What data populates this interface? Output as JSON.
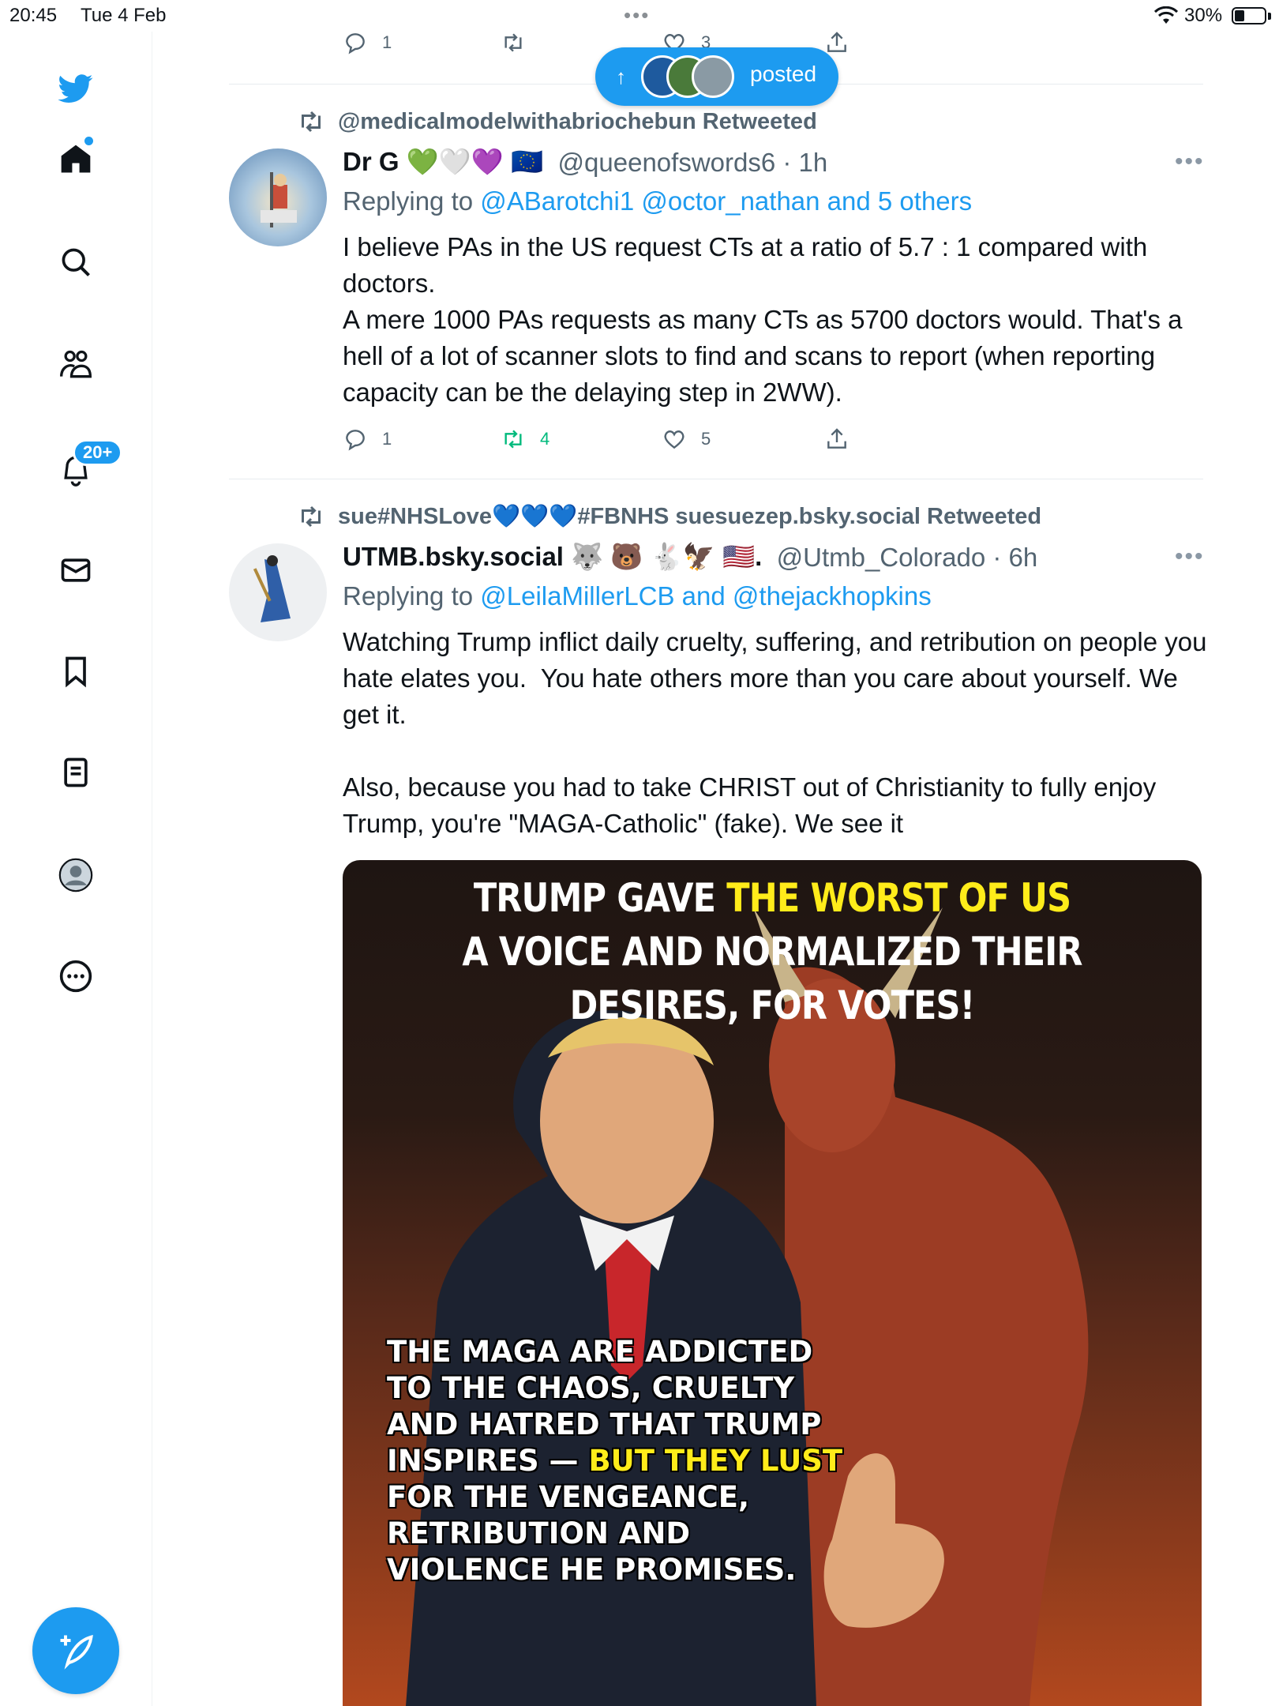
{
  "status_bar": {
    "time": "20:45",
    "date": "Tue 4 Feb",
    "battery": "30%"
  },
  "sidebar": {
    "notif_badge": "20+"
  },
  "new_posts": {
    "label": "posted"
  },
  "top_actions": {
    "reply_count": "1",
    "like_count": "3"
  },
  "tweet1": {
    "retweeted_by": "@medicalmodelwithabriochebun Retweeted",
    "display_name": "Dr G 💚🤍💜 🇪🇺",
    "handle_time": "@queenofswords6 · 1h",
    "replying_prefix": "Replying to ",
    "replying_to": "@ABarotchi1 @octor_nathan and 5 others",
    "text": "I believe PAs in the US request CTs at a ratio of 5.7 : 1 compared with doctors.\nA mere 1000 PAs requests as many CTs as 5700 doctors would. That's a hell of a lot of scanner slots to find and scans to report (when reporting capacity can be the delaying step in 2WW).",
    "reply_count": "1",
    "retweet_count": "4",
    "like_count": "5"
  },
  "tweet2": {
    "retweeted_by": "sue#NHSLove💙💙💙#FBNHS suesuezep.bsky.social Retweeted",
    "display_name": "UTMB.bsky.social 🐺 🐻 🐇🦅 🇺🇸.",
    "handle_time": "@Utmb_Colorado · 6h",
    "replying_prefix": "Replying to ",
    "replying_to": "@LeilaMillerLCB and @thejackhopkins",
    "text": "Watching Trump inflict daily cruelty, suffering, and retribution on people you hate elates you.  You hate others more than you care about yourself. We get it.\n\nAlso, because you had to take CHRIST out of Christianity to fully enjoy Trump, you're \"MAGA-Catholic\" (fake). We see it",
    "meme_top_a": "TRUMP GAVE ",
    "meme_top_b": "THE WORST OF US",
    "meme_top_c": "A VOICE AND NORMALIZED THEIR",
    "meme_top_d": "DESIRES, FOR VOTES!",
    "meme_bottom_1": "THE MAGA ARE ADDICTED",
    "meme_bottom_2": "TO THE CHAOS, CRUELTY",
    "meme_bottom_3": "AND HATRED THAT TRUMP",
    "meme_bottom_4a": "INSPIRES — ",
    "meme_bottom_4b": "BUT THEY LUST",
    "meme_bottom_5": "FOR THE VENGEANCE,",
    "meme_bottom_6": "RETRIBUTION AND",
    "meme_bottom_7": "VIOLENCE HE PROMISES."
  },
  "colors": {
    "accent": "#1d9bf0",
    "retweet_green": "#00ba7c",
    "secondary": "#536471"
  }
}
